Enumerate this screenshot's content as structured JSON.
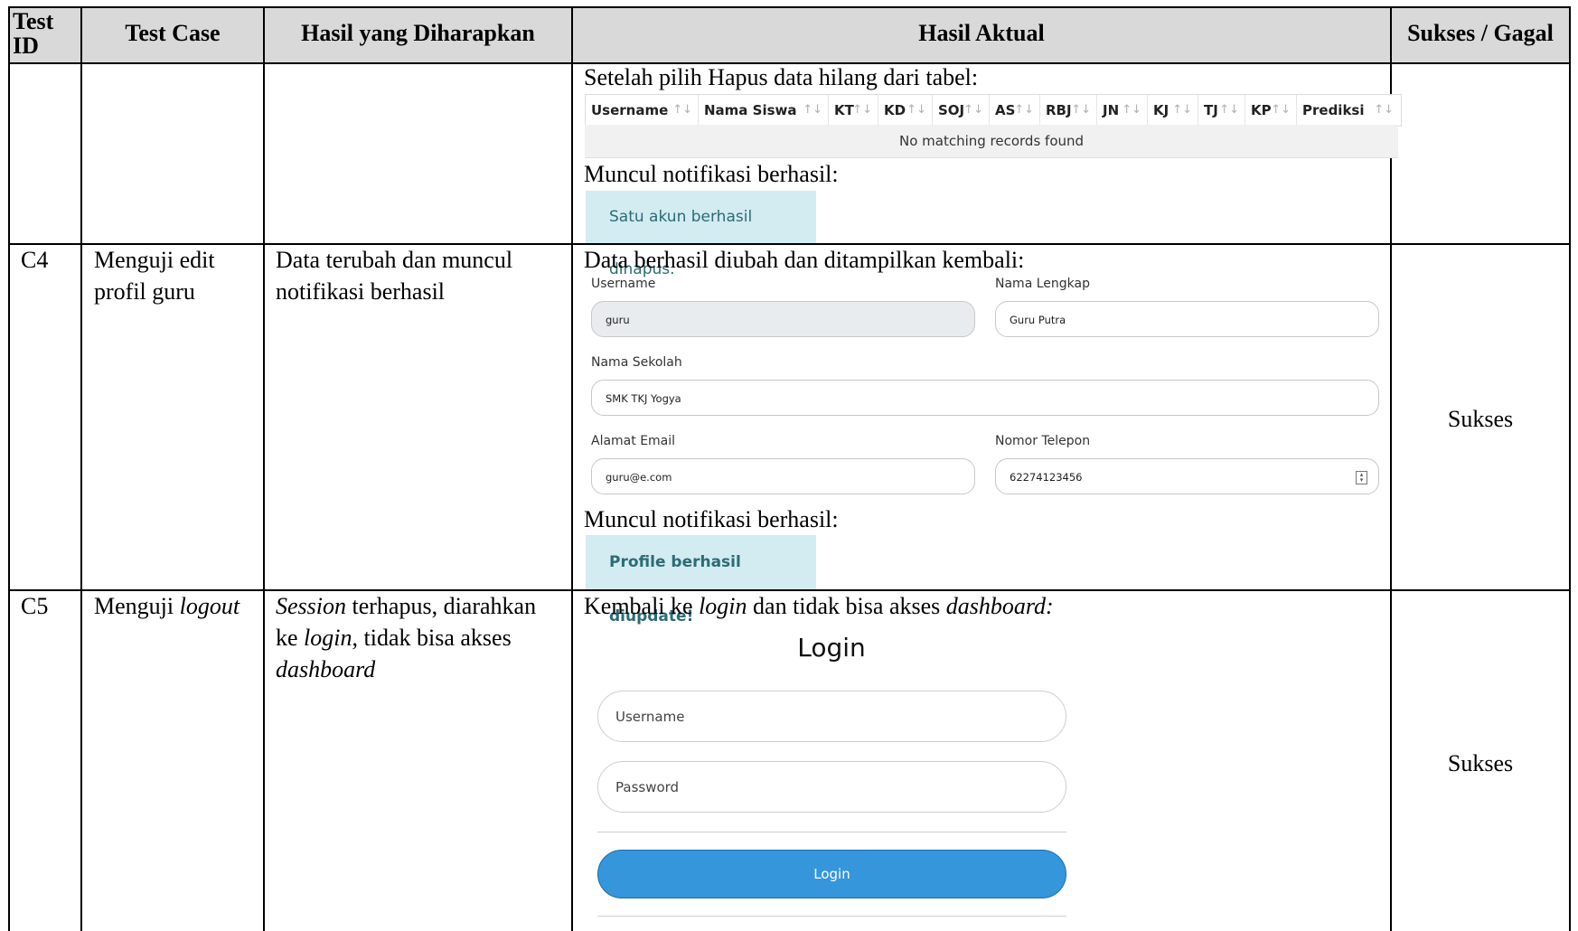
{
  "table": {
    "headers": [
      "Test ID",
      "Test Case",
      "Hasil yang Diharapkan",
      "Hasil Aktual",
      "Sukses / Gagal"
    ],
    "header_test_id_line1": "Test",
    "header_test_id_line2": "ID"
  },
  "row_c3": {
    "actual_intro": "Setelah pilih Hapus data hilang dari tabel:",
    "notif_intro": "Muncul notifikasi berhasil:",
    "alert_text": "Satu akun berhasil dihapus.",
    "datatable": {
      "columns": [
        "Username",
        "Nama Siswa",
        "KT",
        "KD",
        "SOJ",
        "AS",
        "RBJ",
        "JN",
        "KJ",
        "TJ",
        "KP",
        "Prediksi"
      ],
      "sort_icons": [
        "↑↓",
        "↑↓",
        "↑↓",
        "↑↓",
        "↑↓",
        "↑↓",
        "↑↓",
        "↑↓",
        "↑↓",
        "↑↓",
        "↑↓",
        "↑↓"
      ],
      "empty_message": "No matching records found"
    }
  },
  "row_c4": {
    "id": "C4",
    "test_case_line1": "Menguji edit",
    "test_case_line2": "profil guru",
    "expected_line1": "Data terubah dan muncul",
    "expected_line2": "notifikasi berhasil",
    "actual_intro": "Data berhasil diubah dan ditampilkan kembali:",
    "form": {
      "username_label": "Username",
      "username_value": "guru",
      "fullname_label": "Nama Lengkap",
      "fullname_value": "Guru Putra",
      "school_label": "Nama Sekolah",
      "school_value": "SMK TKJ Yogya",
      "email_label": "Alamat Email",
      "email_value": "guru@e.com",
      "phone_label": "Nomor Telepon",
      "phone_value": "62274123456"
    },
    "notif_intro": "Muncul notifikasi berhasil:",
    "alert_text": "Profile berhasil diupdate!",
    "result": "Sukses"
  },
  "row_c5": {
    "id": "C5",
    "test_case_plain": "Menguji ",
    "test_case_italic": "logout",
    "expected": {
      "l1_italic": "Session",
      "l1_plain": " terhapus, diarahkan",
      "l2_plain_a": "ke ",
      "l2_italic": "login",
      "l2_plain_b": ", tidak bisa akses",
      "l3_italic": "dashboard"
    },
    "actual": {
      "a": "Kembali ke ",
      "b_italic": "login",
      "c": " dan tidak bisa akses ",
      "d_italic": "dashboard:"
    },
    "login": {
      "title": "Login",
      "username_placeholder": "Username",
      "password_placeholder": "Password",
      "button_label": "Login"
    },
    "result": "Sukses"
  }
}
